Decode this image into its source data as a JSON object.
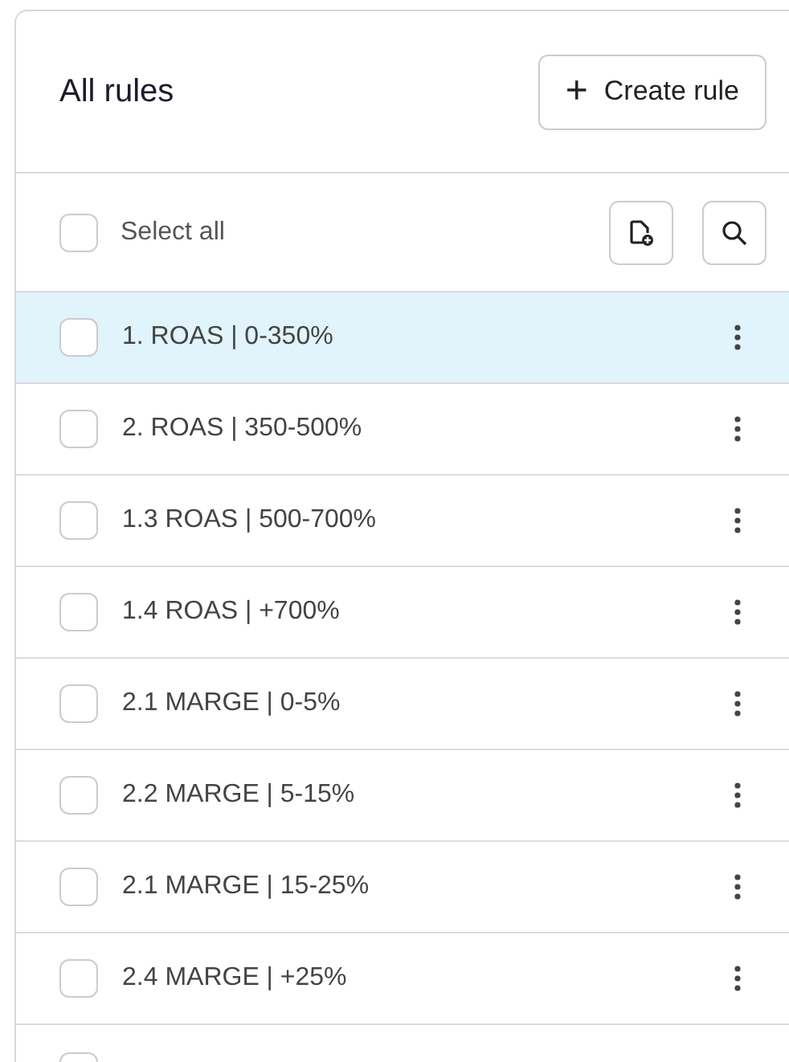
{
  "header": {
    "title": "All rules",
    "create_button": {
      "icon": "+",
      "label": "Create rule"
    }
  },
  "toolbar": {
    "select_all": {
      "label": "Select all",
      "checked": false
    }
  },
  "rules": [
    {
      "label": "1. ROAS | 0-350%",
      "selected": true,
      "checked": false
    },
    {
      "label": "2. ROAS | 350-500%",
      "selected": false,
      "checked": false
    },
    {
      "label": "1.3 ROAS | 500-700%",
      "selected": false,
      "checked": false
    },
    {
      "label": "1.4 ROAS | +700%",
      "selected": false,
      "checked": false
    },
    {
      "label": "2.1 MARGE | 0-5%",
      "selected": false,
      "checked": false
    },
    {
      "label": "2.2 MARGE | 5-15%",
      "selected": false,
      "checked": false
    },
    {
      "label": "2.1 MARGE | 15-25%",
      "selected": false,
      "checked": false
    },
    {
      "label": "2.4 MARGE | +25%",
      "selected": false,
      "checked": false
    }
  ],
  "clipped_row": {
    "checked": false
  }
}
